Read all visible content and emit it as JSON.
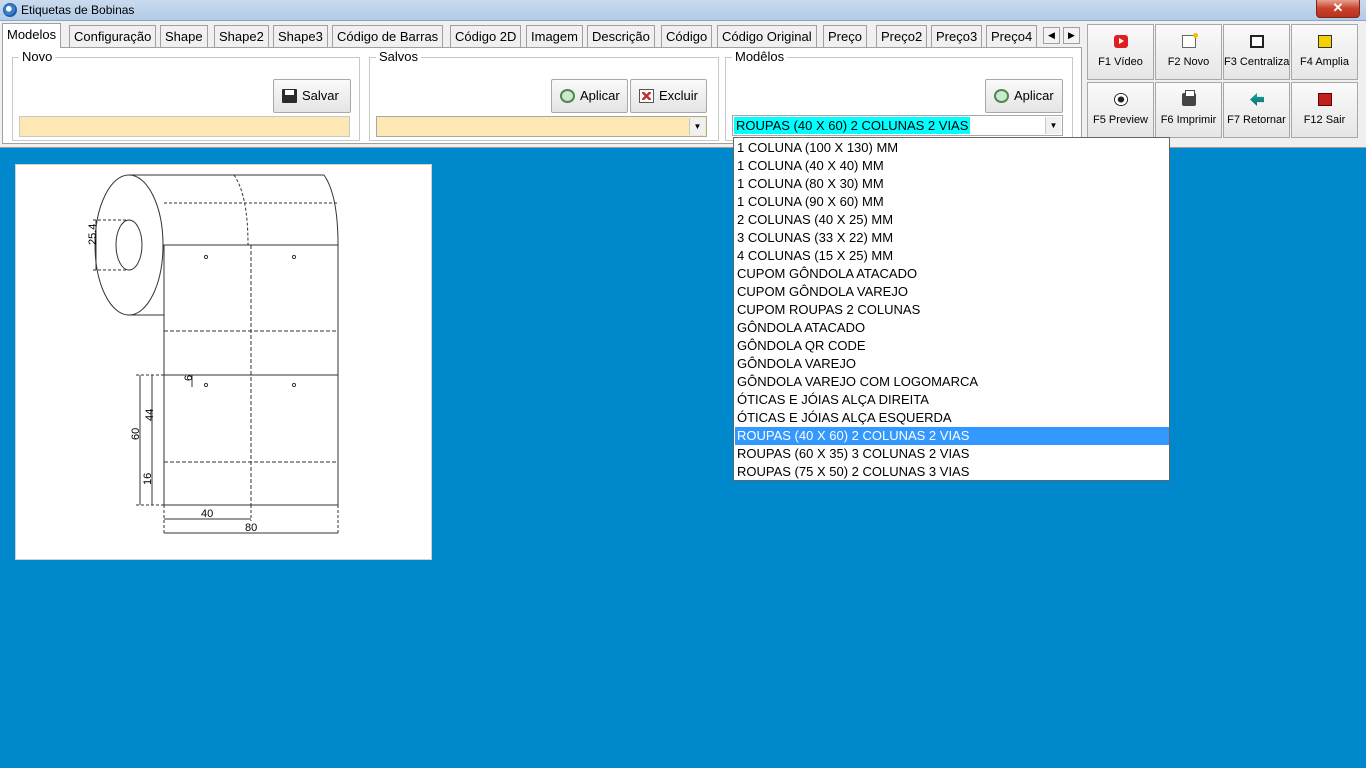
{
  "window": {
    "title": "Etiquetas de Bobinas",
    "close": "✕"
  },
  "tabs": [
    {
      "label": "Modelos",
      "active": true
    },
    {
      "label": "Configuração"
    },
    {
      "label": "Shape"
    },
    {
      "label": "Shape2"
    },
    {
      "label": "Shape3"
    },
    {
      "label": "Código de Barras"
    },
    {
      "label": "Código 2D"
    },
    {
      "label": "Imagem"
    },
    {
      "label": "Descrição"
    },
    {
      "label": "Código"
    },
    {
      "label": "Código Original"
    },
    {
      "label": "Preço"
    },
    {
      "label": "Preço2"
    },
    {
      "label": "Preço3"
    },
    {
      "label": "Preço4"
    }
  ],
  "tab_scroll": {
    "left": "◀",
    "right": "▶"
  },
  "novo": {
    "legend": "Novo",
    "save_label": "Salvar",
    "name_value": ""
  },
  "salvos": {
    "legend": "Salvos",
    "apply_label": "Aplicar",
    "delete_label": "Excluir",
    "selected": ""
  },
  "modelos": {
    "legend": "Modêlos",
    "apply_label": "Aplicar",
    "selected": "ROUPAS (40 X 60) 2 COLUNAS 2 VIAS",
    "arrow": "▼"
  },
  "fkeys": [
    {
      "label": "F1 Vídeo",
      "icon": "video-icon"
    },
    {
      "label": "F2 Novo",
      "icon": "new-document-icon"
    },
    {
      "label": "F3 Centraliza",
      "icon": "center-icon"
    },
    {
      "label": "F4 Amplia",
      "icon": "zoom-icon"
    },
    {
      "label": "F5 Preview",
      "icon": "eye-icon"
    },
    {
      "label": "F6 Imprimir",
      "icon": "printer-icon"
    },
    {
      "label": "F7 Retornar",
      "icon": "back-arrow-icon"
    },
    {
      "label": "F12 Sair",
      "icon": "exit-icon"
    }
  ],
  "dropdown_items": [
    "1 COLUNA (100 X 130) MM",
    "1 COLUNA (40 X 40) MM",
    "1 COLUNA (80 X 30) MM",
    "1 COLUNA (90 X 60) MM",
    "2 COLUNAS (40 X 25) MM",
    "3 COLUNAS (33 X 22) MM",
    "4 COLUNAS (15 X 25) MM",
    "CUPOM GÔNDOLA ATACADO",
    "CUPOM GÔNDOLA VAREJO",
    "CUPOM ROUPAS 2 COLUNAS",
    "GÔNDOLA ATACADO",
    "GÔNDOLA QR CODE",
    "GÔNDOLA VAREJO",
    "GÔNDOLA VAREJO COM LOGOMARCA",
    "ÓTICAS E JÓIAS ALÇA DIREITA",
    "ÓTICAS E JÓIAS ALÇA ESQUERDA",
    "ROUPAS (40 X 60) 2 COLUNAS 2 VIAS",
    "ROUPAS (60 X 35) 3 COLUNAS 2 VIAS",
    "ROUPAS (75 X 50) 2 COLUNAS 3 VIAS"
  ],
  "dropdown_selected_index": 16,
  "drawing": {
    "core_label": "25.4",
    "hole_label": "6",
    "height_label": "60",
    "upper_label": "44",
    "lower_label": "16",
    "col_width_label": "40",
    "total_width_label": "80"
  }
}
